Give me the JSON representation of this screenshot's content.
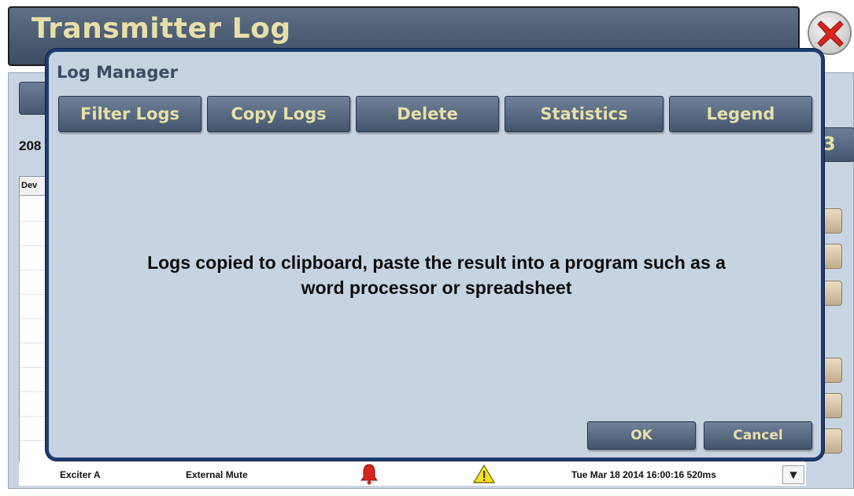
{
  "window": {
    "title": "Transmitter Log",
    "log_count_partial": "208",
    "right_button_partial": "3",
    "table": {
      "column_device_partial": "Dev",
      "visible_row": {
        "device": "Exciter A",
        "event": "External Mute",
        "alarm_icon": "bell-alarm-icon",
        "warning_icon": "warning-triangle-icon",
        "timestamp": "Tue Mar 18 2014 16:00:16 520ms"
      }
    }
  },
  "dialog": {
    "title": "Log Manager",
    "tabs": [
      {
        "label": "Filter Logs"
      },
      {
        "label": "Copy Logs"
      },
      {
        "label": "Delete"
      },
      {
        "label": "Statistics"
      },
      {
        "label": "Legend"
      }
    ],
    "message_line1": "Logs copied to clipboard, paste the result into a program such as a",
    "message_line2": "word processor or spreadsheet",
    "ok_label": "OK",
    "cancel_label": "Cancel"
  },
  "colors": {
    "header_bg": "#4b5c74",
    "title_text": "#e8dfa8",
    "dialog_bg": "#c6d3e1",
    "dialog_border": "#1f3d72",
    "alarm": "#d9241b",
    "warning": "#f5e11c"
  }
}
